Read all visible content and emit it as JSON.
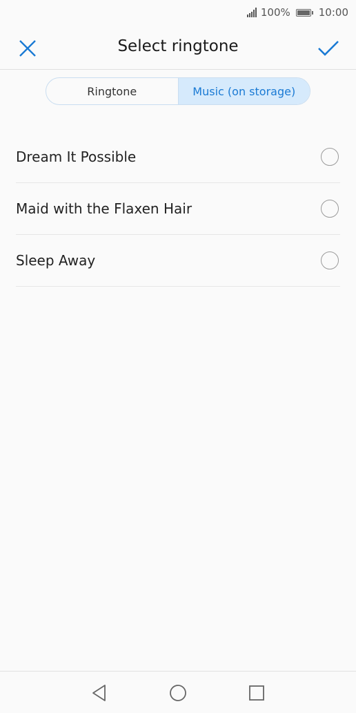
{
  "status_bar": {
    "battery_percent": "100%",
    "time": "10:00",
    "icons": [
      "signal-icon",
      "battery-icon"
    ]
  },
  "header": {
    "title": "Select ringtone",
    "close_icon": "close-icon",
    "confirm_icon": "checkmark-icon",
    "accent_color": "#1a7ad4"
  },
  "tabs": [
    {
      "label": "Ringtone",
      "active": false
    },
    {
      "label": "Music (on storage)",
      "active": true
    }
  ],
  "songs": [
    {
      "label": "Dream It Possible",
      "selected": false
    },
    {
      "label": "Maid with the Flaxen Hair",
      "selected": false
    },
    {
      "label": "Sleep Away",
      "selected": false
    }
  ],
  "nav": {
    "icons": [
      "back-icon",
      "home-icon",
      "recents-icon"
    ]
  }
}
